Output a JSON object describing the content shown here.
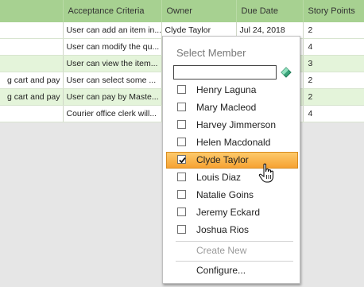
{
  "table": {
    "headers": [
      "",
      "Acceptance Criteria",
      "Owner",
      "Due Date",
      "Story Points"
    ],
    "rows": [
      [
        "",
        "User can add an item in...",
        "Clyde Taylor",
        "Jul 24, 2018",
        "2"
      ],
      [
        "",
        "User can modify the qu...",
        "",
        "",
        "4"
      ],
      [
        "",
        "User can view the item...",
        "",
        "",
        "3"
      ],
      [
        "g cart and pay",
        "User can select some ...",
        "",
        "",
        "2"
      ],
      [
        "g cart and pay",
        "User can pay by Maste...",
        "",
        "",
        "2"
      ],
      [
        "",
        "Courier office clerk will...",
        "",
        "",
        "4"
      ]
    ]
  },
  "popup": {
    "title": "Select Member",
    "search_value": "",
    "clear_icon": "eraser-icon",
    "members": [
      {
        "name": "Henry Laguna",
        "checked": false
      },
      {
        "name": "Mary Macleod",
        "checked": false
      },
      {
        "name": "Harvey Jimmerson",
        "checked": false
      },
      {
        "name": "Helen Macdonald",
        "checked": false
      },
      {
        "name": "Clyde Taylor",
        "checked": true
      },
      {
        "name": "Louis Diaz",
        "checked": false
      },
      {
        "name": "Natalie Goins",
        "checked": false
      },
      {
        "name": "Jeremy Eckard",
        "checked": false
      },
      {
        "name": "Joshua Rios",
        "checked": false
      }
    ],
    "create_new_label": "Create New",
    "configure_label": "Configure..."
  },
  "colors": {
    "header_green": "#a7d191",
    "row_green": "#e4f4da",
    "selected_orange": "#f6a233"
  },
  "cursor_icon": "hand-pointer-icon"
}
